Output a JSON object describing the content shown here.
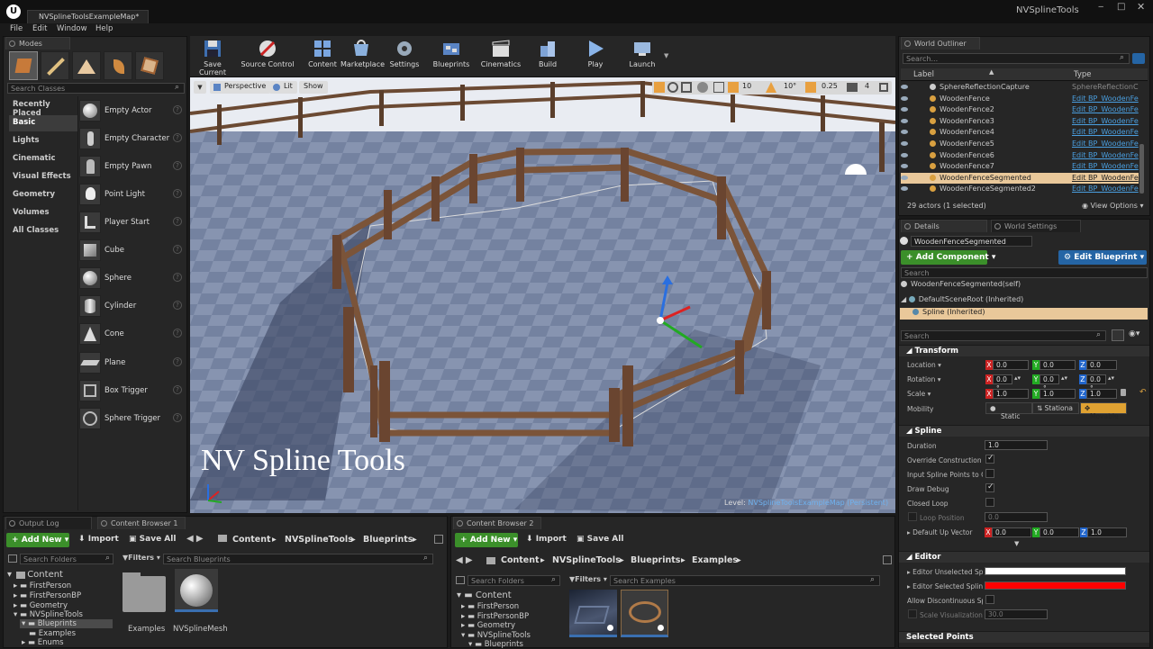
{
  "window": {
    "title": "NVSplineToolsExampleMap*",
    "project": "NVSplineTools"
  },
  "menu": [
    "File",
    "Edit",
    "Window",
    "Help"
  ],
  "modes": {
    "tab": "Modes",
    "search_placeholder": "Search Classes",
    "categories": [
      "Recently Placed",
      "Basic",
      "Lights",
      "Cinematic",
      "Visual Effects",
      "Geometry",
      "Volumes",
      "All Classes"
    ],
    "items": [
      "Empty Actor",
      "Empty Character",
      "Empty Pawn",
      "Point Light",
      "Player Start",
      "Cube",
      "Sphere",
      "Cylinder",
      "Cone",
      "Plane",
      "Box Trigger",
      "Sphere Trigger"
    ]
  },
  "toolbar": [
    {
      "label": "Save Current",
      "icon": "save-icon"
    },
    {
      "label": "Source Control",
      "icon": "source-control-icon"
    },
    {
      "label": "Content",
      "icon": "content-icon"
    },
    {
      "label": "Marketplace",
      "icon": "marketplace-icon"
    },
    {
      "label": "Settings",
      "icon": "settings-icon"
    },
    {
      "label": "Blueprints",
      "icon": "blueprints-icon"
    },
    {
      "label": "Cinematics",
      "icon": "cinematics-icon"
    },
    {
      "label": "Build",
      "icon": "build-icon"
    },
    {
      "label": "Play",
      "icon": "play-icon"
    },
    {
      "label": "Launch",
      "icon": "launch-icon"
    }
  ],
  "viewport": {
    "perspective": "Perspective",
    "lit": "Lit",
    "show": "Show",
    "snap": [
      "10",
      "10°",
      "0.25",
      "4"
    ],
    "overlay_title": "NV Spline Tools",
    "level_label": "Level:",
    "level_name": "NVSplineToolsExampleMap (Persistent)"
  },
  "outliner": {
    "tab": "World Outliner",
    "search_placeholder": "Search...",
    "col_label": "Label",
    "col_type": "Type",
    "rows": [
      {
        "label": "SphereReflectionCapture",
        "type": "SphereReflectionCa",
        "link": false,
        "selected": false
      },
      {
        "label": "WoodenFence",
        "type": "Edit BP_WoodenFe",
        "link": true,
        "selected": false
      },
      {
        "label": "WoodenFence2",
        "type": "Edit BP_WoodenFe",
        "link": true,
        "selected": false
      },
      {
        "label": "WoodenFence3",
        "type": "Edit BP_WoodenFe",
        "link": true,
        "selected": false
      },
      {
        "label": "WoodenFence4",
        "type": "Edit BP_WoodenFe",
        "link": true,
        "selected": false
      },
      {
        "label": "WoodenFence5",
        "type": "Edit BP_WoodenFe",
        "link": true,
        "selected": false
      },
      {
        "label": "WoodenFence6",
        "type": "Edit BP_WoodenFe",
        "link": true,
        "selected": false
      },
      {
        "label": "WoodenFence7",
        "type": "Edit BP_WoodenFe",
        "link": true,
        "selected": false
      },
      {
        "label": "WoodenFenceSegmented",
        "type": "Edit BP_WoodenFe",
        "link": true,
        "selected": true
      },
      {
        "label": "WoodenFenceSegmented2",
        "type": "Edit BP_WoodenFe",
        "link": true,
        "selected": false
      }
    ],
    "count": "29 actors (1 selected)",
    "view_options": "View Options"
  },
  "details": {
    "tab": "Details",
    "tab2": "World Settings",
    "name": "WoodenFenceSegmented",
    "add_component": "Add Component",
    "edit_blueprint": "Edit Blueprint",
    "search_placeholder": "Search",
    "self": "WoodenFenceSegmented(self)",
    "root": "DefaultSceneRoot (Inherited)",
    "spline": "Spline (Inherited)",
    "search2_placeholder": "Search",
    "transform": {
      "title": "Transform",
      "location": {
        "label": "Location",
        "x": "0.0",
        "y": "0.0",
        "z": "0.0"
      },
      "rotation": {
        "label": "Rotation",
        "x": "0.0 °",
        "y": "0.0 °",
        "z": "0.0 °"
      },
      "scale": {
        "label": "Scale",
        "x": "1.0",
        "y": "1.0",
        "z": "1.0"
      },
      "mobility": {
        "label": "Mobility",
        "static": "Static",
        "stationary": "Stationa",
        "movable": "Movable"
      }
    },
    "spline_section": {
      "title": "Spline",
      "duration": {
        "label": "Duration",
        "value": "1.0"
      },
      "override": "Override Construction Sc",
      "input_points": "Input Spline Points to Co",
      "draw_debug": "Draw Debug",
      "closed_loop": "Closed Loop",
      "loop_position": {
        "label": "Loop Position",
        "value": "0.0"
      },
      "default_up": {
        "label": "Default Up Vector",
        "x": "0.0",
        "y": "0.0",
        "z": "1.0"
      }
    },
    "editor_section": {
      "title": "Editor",
      "unselected": "Editor Unselected Spline",
      "selected": "Editor Selected Spline Se",
      "discontinuous": "Allow Discontinuous Spli",
      "scale_vis": {
        "label": "Scale Visualization W",
        "value": "30.0"
      },
      "unselected_color": "#ffffff",
      "selected_color": "#ff0000"
    },
    "selected_points": "Selected Points"
  },
  "bottom_left": {
    "tab_output": "Output Log",
    "tab_cb": "Content Browser 1",
    "add_new": "Add New",
    "import": "Import",
    "save_all": "Save All",
    "path": [
      "Content",
      "NVSplineTools",
      "Blueprints"
    ],
    "search_folders": "Search Folders",
    "filters": "Filters",
    "search_assets": "Search Blueprints",
    "tree": [
      "Content",
      "FirstPerson",
      "FirstPersonBP",
      "Geometry",
      "NVSplineTools",
      "Blueprints",
      "Examples",
      "Enums"
    ],
    "assets": [
      "Examples",
      "NVSplineMesh"
    ]
  },
  "bottom_mid": {
    "tab": "Content Browser 2",
    "add_new": "Add New",
    "import": "Import",
    "save_all": "Save All",
    "path": [
      "Content",
      "NVSplineTools",
      "Blueprints",
      "Examples"
    ],
    "search_folders": "Search Folders",
    "filters": "Filters",
    "search_assets": "Search Examples",
    "tree": [
      "Content",
      "FirstPerson",
      "FirstPersonBP",
      "Geometry",
      "NVSplineTools",
      "Blueprints"
    ]
  }
}
